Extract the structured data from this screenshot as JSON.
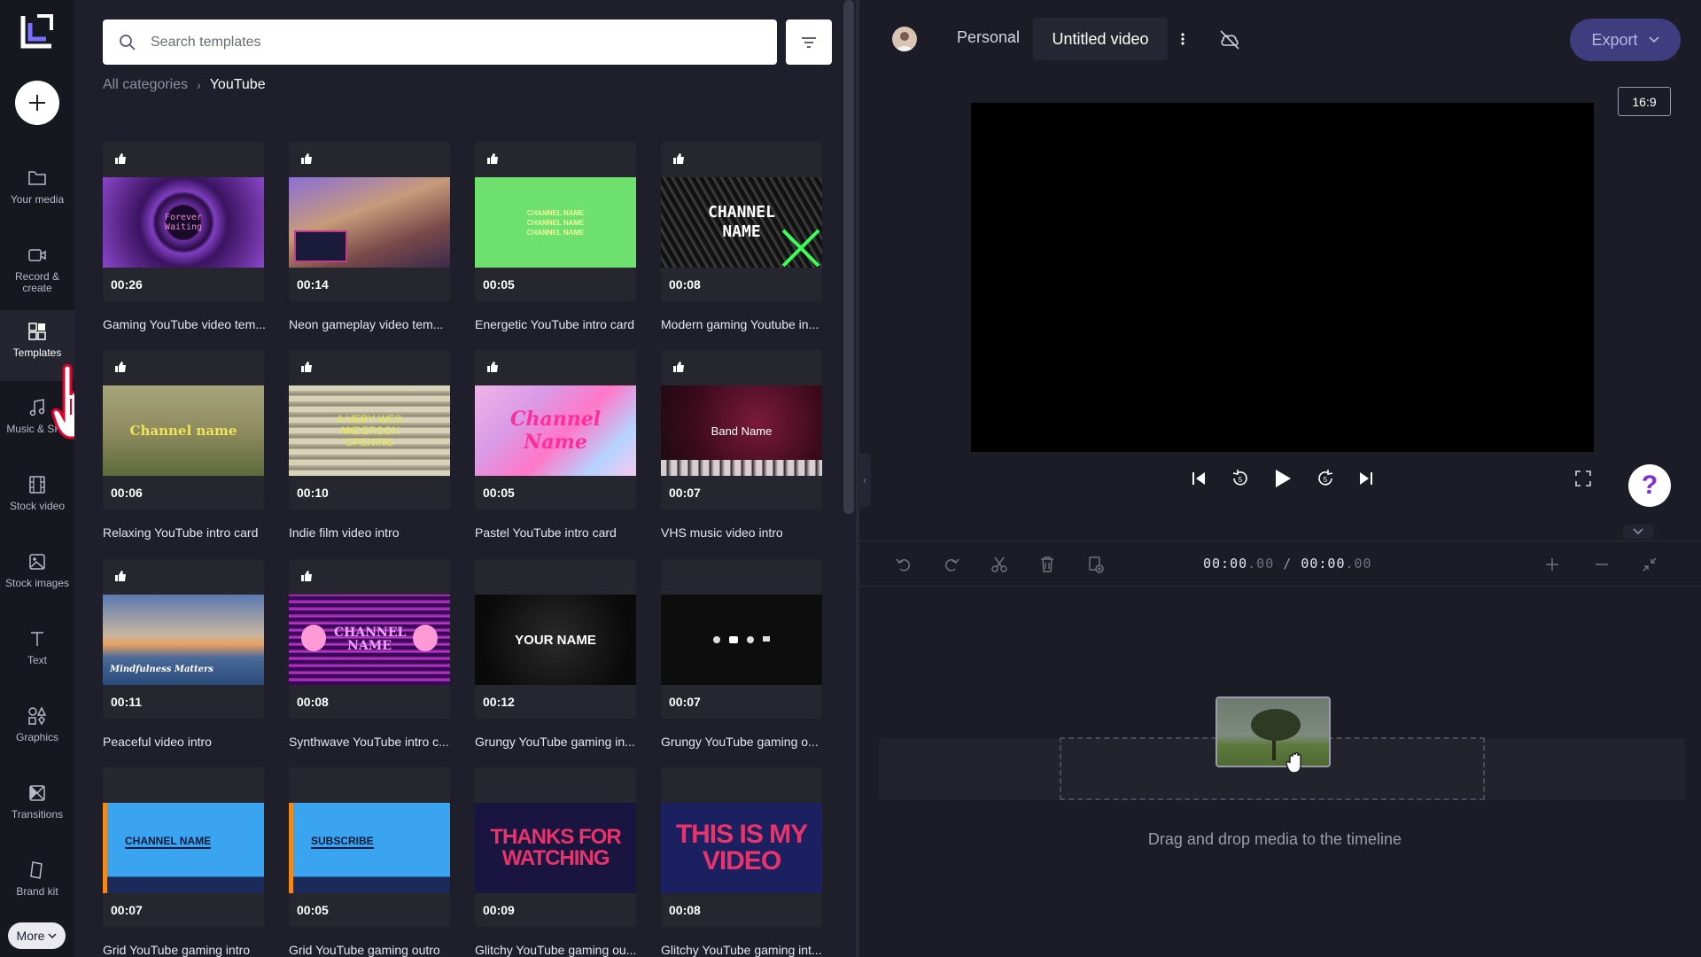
{
  "rail": {
    "items": [
      {
        "label": "Your media",
        "icon": "folder-icon"
      },
      {
        "label": "Record & create",
        "icon": "camera-icon"
      },
      {
        "label": "Templates",
        "icon": "templates-icon"
      },
      {
        "label": "Music & SFX",
        "icon": "music-icon"
      },
      {
        "label": "Stock video",
        "icon": "film-icon"
      },
      {
        "label": "Stock images",
        "icon": "image-icon"
      },
      {
        "label": "Text",
        "icon": "text-icon"
      },
      {
        "label": "Graphics",
        "icon": "shapes-icon"
      },
      {
        "label": "Transitions",
        "icon": "transitions-icon"
      },
      {
        "label": "Brand kit",
        "icon": "brand-kit-icon"
      }
    ],
    "more_label": "More"
  },
  "templates": {
    "search_placeholder": "Search templates",
    "breadcrumb": {
      "root": "All categories",
      "current": "YouTube"
    },
    "cards": [
      {
        "duration": "00:26",
        "title": "Gaming YouTube video tem...",
        "thumb_text": "Forever Waiting"
      },
      {
        "duration": "00:14",
        "title": "Neon gameplay video tem...",
        "thumb_text": ""
      },
      {
        "duration": "00:05",
        "title": "Energetic YouTube intro card",
        "thumb_text": "CHANNEL NAME CHANNEL NAME CHANNEL NAME"
      },
      {
        "duration": "00:08",
        "title": "Modern gaming Youtube in...",
        "thumb_text": "CHANNEL NAME"
      },
      {
        "duration": "00:06",
        "title": "Relaxing YouTube intro card",
        "thumb_text": "Channel name"
      },
      {
        "duration": "00:10",
        "title": "Indie film video intro",
        "thumb_text": "A VERY WES ANDERSON OPENING"
      },
      {
        "duration": "00:05",
        "title": "Pastel YouTube intro card",
        "thumb_text": "Channel Name"
      },
      {
        "duration": "00:07",
        "title": "VHS music video intro",
        "thumb_text": "Band Name"
      },
      {
        "duration": "00:11",
        "title": "Peaceful video intro",
        "thumb_text": "Mindfulness Matters"
      },
      {
        "duration": "00:08",
        "title": "Synthwave YouTube intro c...",
        "thumb_text": "CHANNEL NAME"
      },
      {
        "duration": "00:12",
        "title": "Grungy YouTube gaming in...",
        "thumb_text": "YOUR NAME"
      },
      {
        "duration": "00:07",
        "title": "Grungy YouTube gaming o...",
        "thumb_text": ""
      },
      {
        "duration": "00:07",
        "title": "Grid YouTube gaming intro",
        "thumb_text": "CHANNEL NAME"
      },
      {
        "duration": "00:05",
        "title": "Grid YouTube gaming outro",
        "thumb_text": "SUBSCRIBE"
      },
      {
        "duration": "00:09",
        "title": "Glitchy YouTube gaming ou...",
        "thumb_text": "THANKS FOR WATCHING"
      },
      {
        "duration": "00:08",
        "title": "Glitchy YouTube gaming int...",
        "thumb_text": "THIS IS MY VIDEO"
      }
    ]
  },
  "editor": {
    "workspace": "Personal",
    "video_title": "Untitled video",
    "export_label": "Export",
    "aspect_ratio": "16:9",
    "help_label": "?",
    "timecode": {
      "current_main": "00:00",
      "current_frac": ".00",
      "total_main": "00:00",
      "total_frac": ".00",
      "separator": "/"
    },
    "drop_hint": "Drag and drop media to the timeline"
  },
  "colors": {
    "accent": "#3f3c80",
    "rail_bg": "#17171f",
    "panel_bg": "#1f1f2c"
  }
}
